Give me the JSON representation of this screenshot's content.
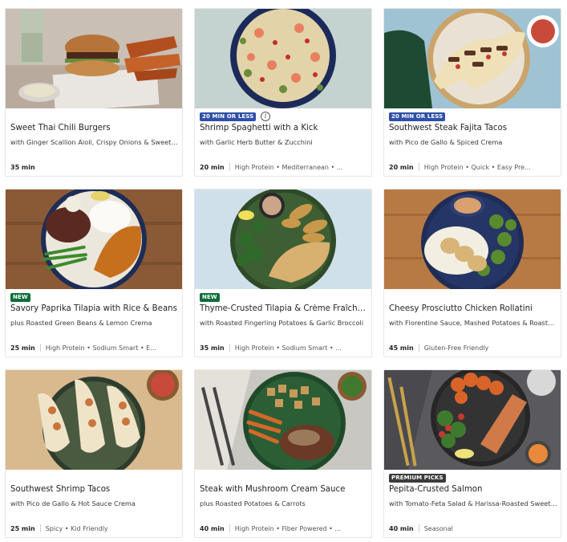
{
  "recipes": [
    {
      "badge": "",
      "title": "Sweet Thai Chili Burgers",
      "subtitle": "with Ginger Scallion Aioli, Crispy Onions & Sweet Po...",
      "time": "35 min",
      "tags": ""
    },
    {
      "badge": "20 MIN OR LESS",
      "title": "Shrimp Spaghetti with a Kick",
      "subtitle": "with Garlic Herb Butter & Zucchini",
      "time": "20 min",
      "tags": "High Protein • Mediterranean • ..."
    },
    {
      "badge": "20 MIN OR LESS",
      "title": "Southwest Steak Fajita Tacos",
      "subtitle": "with Pico de Gallo & Spiced Crema",
      "time": "20 min",
      "tags": "High Protein • Quick • Easy Pre..."
    },
    {
      "badge": "NEW",
      "title": "Savory Paprika Tilapia with Rice & Beans",
      "subtitle": "plus Roasted Green Beans & Lemon Crema",
      "time": "25 min",
      "tags": "High Protein • Sodium Smart • E..."
    },
    {
      "badge": "NEW",
      "title": "Thyme-Crusted Tilapia & Crème Fraîche...",
      "subtitle": "with Roasted Fingerling Potatoes & Garlic Broccoli",
      "time": "35 min",
      "tags": "High Protein • Sodium Smart • ..."
    },
    {
      "badge": "",
      "title": "Cheesy Prosciutto Chicken Rollatini",
      "subtitle": "with Florentine Sauce, Mashed Potatoes & Roasted ...",
      "time": "45 min",
      "tags": "Gluten-Free Friendly"
    },
    {
      "badge": "",
      "title": "Southwest Shrimp Tacos",
      "subtitle": "with Pico de Gallo & Hot Sauce Crema",
      "time": "25 min",
      "tags": "Spicy • Kid Friendly"
    },
    {
      "badge": "",
      "title": "Steak with Mushroom Cream Sauce",
      "subtitle": "plus Roasted Potatoes & Carrots",
      "time": "40 min",
      "tags": "High Protein • Fiber Powered • ..."
    },
    {
      "badge": "PREMIUM PICKS",
      "title": "Pepita-Crusted Salmon",
      "subtitle": "with Tomato-Feta Salad & Harissa-Roasted Sweet Po...",
      "time": "40 min",
      "tags": "Seasonal"
    }
  ],
  "colors": {
    "badge_fast": "#2f50a8",
    "badge_new": "#0b6e3a",
    "badge_premium": "#3b3b3b",
    "card_border": "#e6e6e6"
  },
  "icons": {
    "info": "info-icon"
  }
}
